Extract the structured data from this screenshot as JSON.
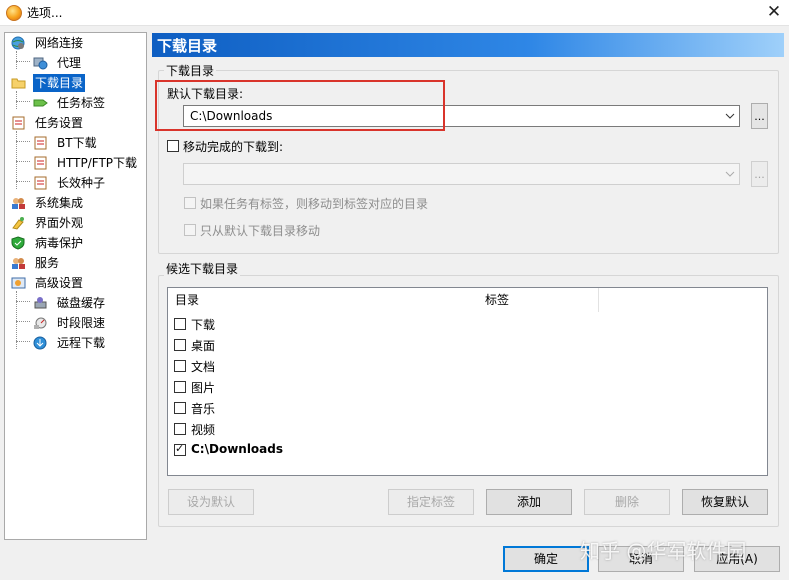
{
  "window": {
    "title": "选项...",
    "close_glyph": "✕"
  },
  "sidebar": {
    "items": [
      {
        "label": "网络连接",
        "icon": "globe-network-icon"
      },
      {
        "label": "代理",
        "icon": "proxy-globe-icon"
      },
      {
        "label": "下载目录",
        "icon": "folder-icon",
        "selected": true
      },
      {
        "label": "任务标签",
        "icon": "tag-icon"
      },
      {
        "label": "任务设置",
        "icon": "clipboard-settings-icon"
      },
      {
        "label": "BT下载",
        "icon": "clipboard-icon"
      },
      {
        "label": "HTTP/FTP下载",
        "icon": "clipboard-icon"
      },
      {
        "label": "长效种子",
        "icon": "clipboard-icon"
      },
      {
        "label": "系统集成",
        "icon": "users-icon"
      },
      {
        "label": "界面外观",
        "icon": "paint-icon"
      },
      {
        "label": "病毒保护",
        "icon": "shield-icon"
      },
      {
        "label": "服务",
        "icon": "users-icon"
      },
      {
        "label": "高级设置",
        "icon": "advanced-settings-icon"
      },
      {
        "label": "磁盘缓存",
        "icon": "disk-cache-icon"
      },
      {
        "label": "时段限速",
        "icon": "speed-limit-icon"
      },
      {
        "label": "远程下载",
        "icon": "remote-download-icon"
      }
    ]
  },
  "header": {
    "title": "下载目录"
  },
  "download_dir": {
    "group_title": "下载目录",
    "default_label": "默认下载目录:",
    "default_value": "C:\\Downloads",
    "browse_label": "...",
    "move_label": "移动完成的下载到:",
    "move_checked": false,
    "move_value": "",
    "move_browse_label": "...",
    "option_tag_label": "如果任务有标签，则移动到标签对应的目录",
    "option_default_only_label": "只从默认下载目录移动"
  },
  "candidates": {
    "group_title": "候选下载目录",
    "columns": [
      "目录",
      "标签"
    ],
    "rows": [
      {
        "name": "下载",
        "checked": false,
        "bold": false
      },
      {
        "name": "桌面",
        "checked": false,
        "bold": false
      },
      {
        "name": "文档",
        "checked": false,
        "bold": false
      },
      {
        "name": "图片",
        "checked": false,
        "bold": false
      },
      {
        "name": "音乐",
        "checked": false,
        "bold": false
      },
      {
        "name": "视频",
        "checked": false,
        "bold": false
      },
      {
        "name": "C:\\Downloads",
        "checked": true,
        "bold": true
      }
    ],
    "buttons": {
      "set_default": "设为默认",
      "assign_tag": "指定标签",
      "add": "添加",
      "delete": "删除",
      "restore_default": "恢复默认"
    }
  },
  "footer": {
    "ok": "确定",
    "cancel": "取消",
    "apply": "应用(A)"
  },
  "watermark": "知乎 @华军软件园",
  "colors": {
    "selection": "#0a64c8",
    "highlight_box": "#d9342b",
    "header_gradient_start": "#0e5ec2"
  }
}
